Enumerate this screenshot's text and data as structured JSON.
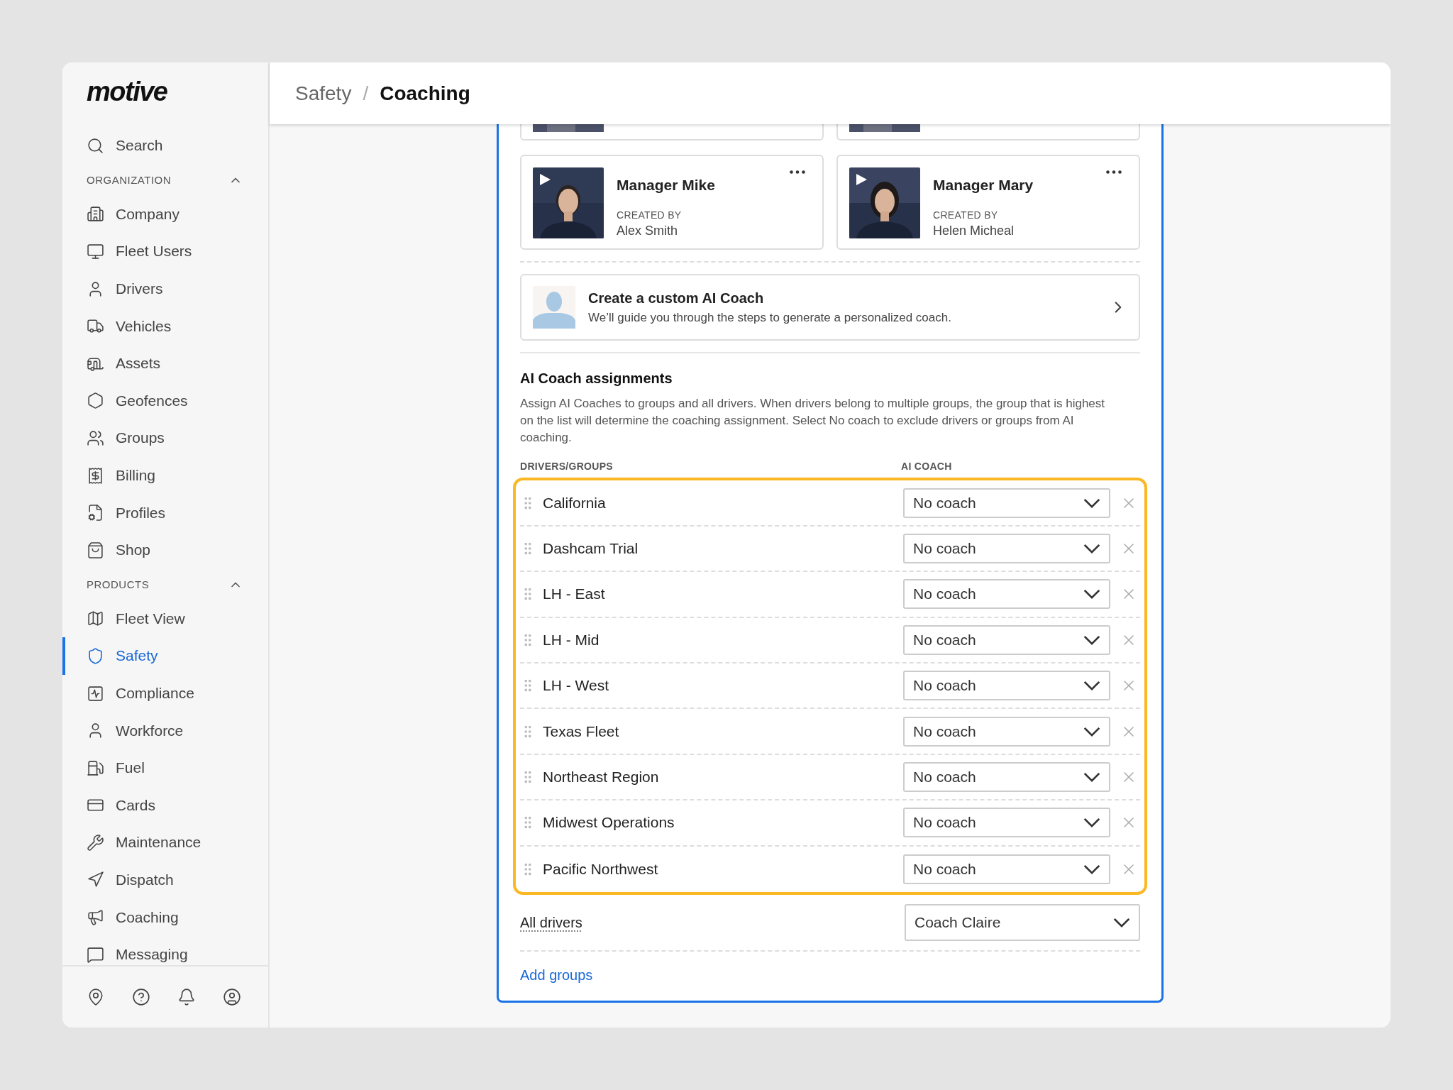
{
  "sidebar": {
    "logo": "motive",
    "search": "Search",
    "sections": [
      {
        "title": "ORGANIZATION",
        "expanded": true,
        "items": [
          {
            "label": "Company",
            "selected": false
          },
          {
            "label": "Fleet Users",
            "selected": false
          },
          {
            "label": "Drivers",
            "selected": false
          },
          {
            "label": "Vehicles",
            "selected": false
          },
          {
            "label": "Assets",
            "selected": false
          },
          {
            "label": "Geofences",
            "selected": false
          },
          {
            "label": "Groups",
            "selected": false
          },
          {
            "label": "Billing",
            "selected": false
          },
          {
            "label": "Profiles",
            "selected": false
          },
          {
            "label": "Shop",
            "selected": false
          }
        ]
      },
      {
        "title": "PRODUCTS",
        "expanded": true,
        "items": [
          {
            "label": "Fleet View",
            "selected": false
          },
          {
            "label": "Safety",
            "selected": true
          },
          {
            "label": "Compliance",
            "selected": false
          },
          {
            "label": "Workforce",
            "selected": false
          },
          {
            "label": "Fuel",
            "selected": false
          },
          {
            "label": "Cards",
            "selected": false
          },
          {
            "label": "Maintenance",
            "selected": false
          },
          {
            "label": "Dispatch",
            "selected": false
          },
          {
            "label": "Coaching",
            "selected": false
          },
          {
            "label": "Messaging",
            "selected": false
          }
        ]
      }
    ]
  },
  "breadcrumb": [
    {
      "label": "Safety",
      "current": false
    },
    {
      "label": "Coaching",
      "current": true
    }
  ],
  "breadcrumb_separator": "/",
  "coach_cards": [
    {
      "clipped": true
    },
    {
      "clipped": true
    },
    {
      "clipped": false,
      "name": "Manager Mike",
      "created_by_label": "CREATED BY",
      "created_by": "Alex Smith"
    },
    {
      "clipped": false,
      "name": "Manager Mary",
      "created_by_label": "CREATED BY",
      "created_by": "Helen Micheal"
    }
  ],
  "create_card": {
    "title": "Create a custom AI Coach",
    "description": "We’ll guide you through the steps to generate a personalized coach."
  },
  "assignments": {
    "title": "AI Coach assignments",
    "description": "Assign AI Coaches to groups and all drivers. When drivers belong to multiple groups, the group that is highest on the list will determine the coaching assignment. Select No coach to exclude drivers or groups from AI coaching.",
    "columns": [
      "DRIVERS/GROUPS",
      "AI COACH"
    ],
    "highlighted": true,
    "rows": [
      {
        "group": "California",
        "coach": "No coach"
      },
      {
        "group": "Dashcam Trial",
        "coach": "No coach"
      },
      {
        "group": "LH - East",
        "coach": "No coach"
      },
      {
        "group": "LH - Mid",
        "coach": "No coach"
      },
      {
        "group": "LH - West",
        "coach": "No coach"
      },
      {
        "group": "Texas Fleet",
        "coach": "No coach"
      },
      {
        "group": "Northeast Region",
        "coach": "No coach"
      },
      {
        "group": "Midwest Operations",
        "coach": "No coach"
      },
      {
        "group": "Pacific Northwest",
        "coach": "No coach"
      }
    ],
    "all_drivers": {
      "label": "All drivers",
      "coach": "Coach Claire"
    },
    "add_link": "Add groups"
  }
}
